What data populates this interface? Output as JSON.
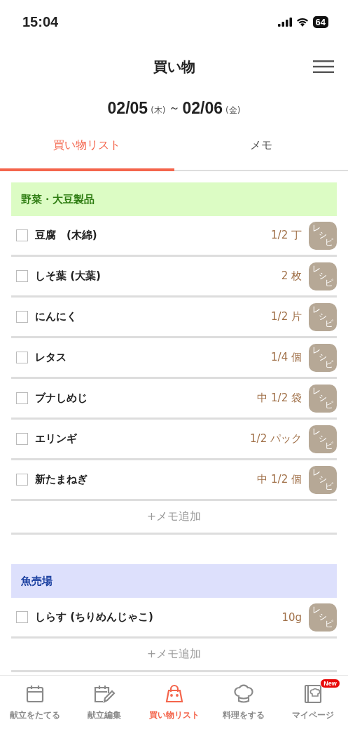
{
  "status_bar": {
    "time": "15:04",
    "battery": "64"
  },
  "header": {
    "title": "買い物"
  },
  "date_range": {
    "start": "02/05",
    "start_day": "(木)",
    "separator": "～",
    "end": "02/06",
    "end_day": "(金)"
  },
  "tabs": [
    {
      "label": "買い物リスト",
      "selected": true
    },
    {
      "label": "メモ",
      "selected": false
    }
  ],
  "sections": [
    {
      "title": "野菜・大豆製品",
      "color": "#dcfcc4",
      "items": [
        {
          "name": "豆腐　(木綿)",
          "amount": "1/2 丁",
          "checked": false,
          "recipe": "レシピ"
        },
        {
          "name": "しそ葉 (大葉)",
          "amount": "2 枚",
          "checked": false,
          "recipe": "レシピ"
        },
        {
          "name": "にんにく",
          "amount": "1/2 片",
          "checked": false,
          "recipe": "レシピ"
        },
        {
          "name": "レタス",
          "amount": "1/4 個",
          "checked": false,
          "recipe": "レシピ"
        },
        {
          "name": "ブナしめじ",
          "amount": "中 1/2 袋",
          "checked": false,
          "recipe": "レシピ"
        },
        {
          "name": "エリンギ",
          "amount": "1/2 パック",
          "checked": false,
          "recipe": "レシピ"
        },
        {
          "name": "新たまねぎ",
          "amount": "中 1/2 個",
          "checked": false,
          "recipe": "レシピ"
        }
      ],
      "add_memo": "+メモ追加"
    },
    {
      "title": "魚売場",
      "color": "#dde0fc",
      "items": [
        {
          "name": "しらす (ちりめんじゃこ)",
          "amount": "10g",
          "checked": false,
          "recipe": "レシピ"
        }
      ],
      "add_memo": "+メモ追加"
    }
  ],
  "bottom_nav": [
    {
      "label": "献立をたてる",
      "selected": false
    },
    {
      "label": "献立編集",
      "selected": false
    },
    {
      "label": "買い物リスト",
      "selected": true
    },
    {
      "label": "料理をする",
      "selected": false
    },
    {
      "label": "マイページ",
      "selected": false,
      "badge": "New"
    }
  ]
}
